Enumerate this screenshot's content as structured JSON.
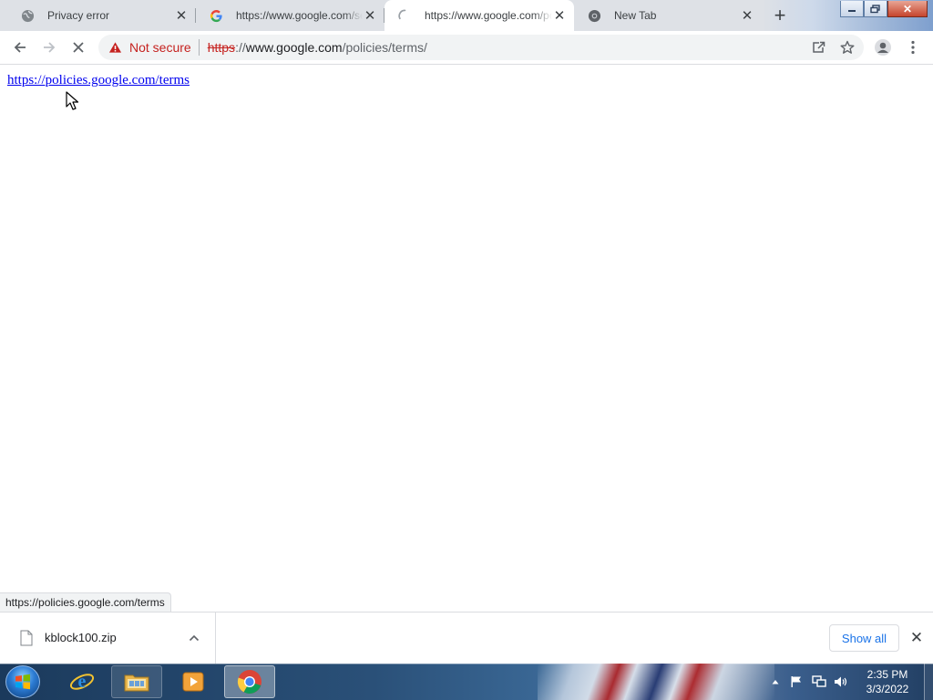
{
  "tabs": [
    {
      "title": "Privacy error",
      "favicon": "globe-icon",
      "active": false
    },
    {
      "title": "https://www.google.com/search",
      "favicon": "google-g-icon",
      "active": false
    },
    {
      "title": "https://www.google.com/policies/terms/",
      "favicon": "loading-spinner-icon",
      "active": true
    },
    {
      "title": "New Tab",
      "favicon": "chrome-icon",
      "active": false
    }
  ],
  "tab_close_glyph": "✕",
  "new_tab_glyph": "+",
  "toolbar": {
    "security_label": "Not secure",
    "url_scheme": "https",
    "url_sep": "://",
    "url_host": "www.google.com",
    "url_path": "/policies/terms/"
  },
  "page": {
    "link_text": "https://policies.google.com/terms",
    "status_url": "https://policies.google.com/terms"
  },
  "downloads": {
    "file_name": "kblock100.zip",
    "show_all_label": "Show all",
    "close_glyph": "✕"
  },
  "taskbar": {
    "time": "2:35 PM",
    "date": "3/3/2022",
    "pinned": [
      "start-orb",
      "internet-explorer-icon",
      "windows-explorer-icon",
      "media-player-icon",
      "chrome-icon"
    ]
  },
  "colors": {
    "not_secure_red": "#c5221f",
    "link_blue": "#0000ee",
    "accent_blue": "#1a73e8",
    "tabstrip_bg": "#dee1e6"
  }
}
